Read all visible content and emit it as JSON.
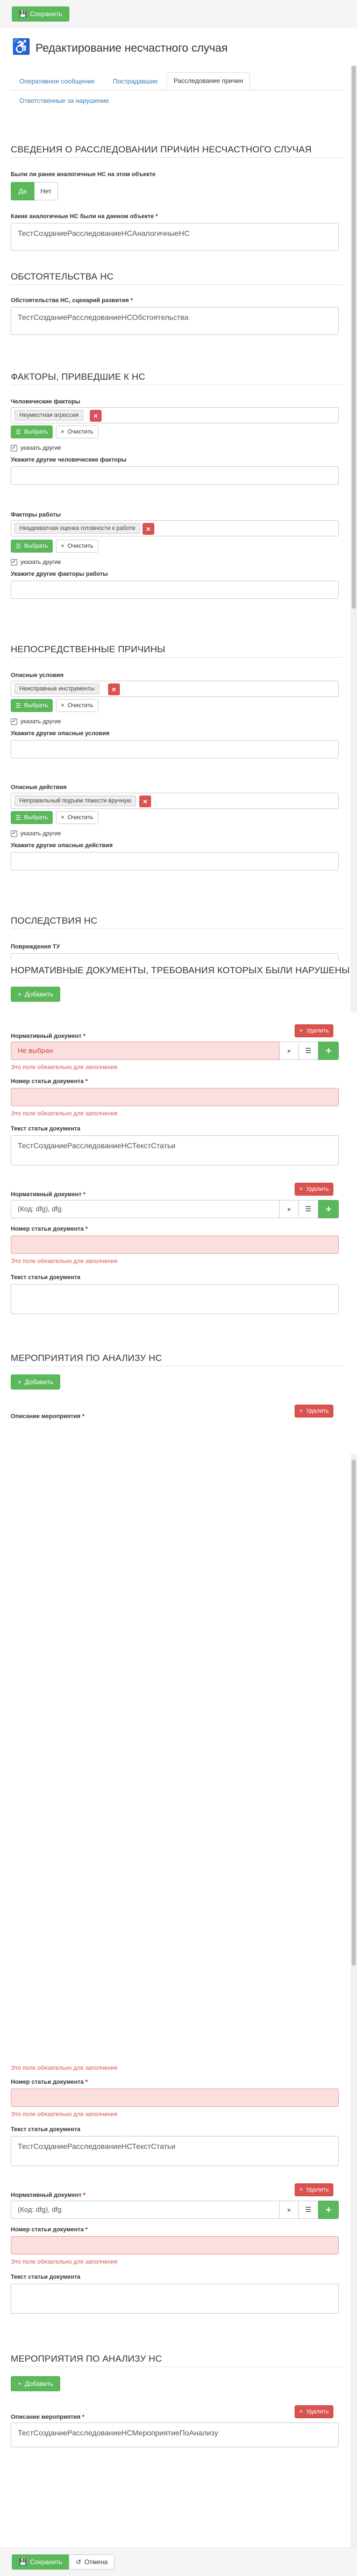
{
  "toolbar": {
    "save_label": "Сохранить"
  },
  "header": {
    "title": "Редактирование несчастного случая"
  },
  "tabs": [
    {
      "label": "Оперативное сообщение"
    },
    {
      "label": "Пострадавшие"
    },
    {
      "label": "Расследование причин"
    },
    {
      "label": "Ответственные за нарушение"
    }
  ],
  "sections": {
    "investigation": "СВЕДЕНИЯ О РАССЛЕДОВАНИИ ПРИЧИН НЕСЧАСТНОГО СЛУЧАЯ",
    "circumstances": "ОБСТОЯТЕЛЬСТВА НС",
    "factors": "ФАКТОРЫ, ПРИВЕДШИЕ К НС",
    "direct_causes": "НЕПОСРЕДСТВЕННЫЕ ПРИЧИНЫ",
    "consequences": "ПОСЛЕДСТВИЯ НС",
    "norm_docs": "НОРМАТИВНЫЕ ДОКУМЕНТЫ, ТРЕБОВАНИЯ КОТОРЫХ БЫЛИ НАРУШЕНЫ",
    "measures": "МЕРОПРИЯТИЯ ПО АНАЛИЗУ НС",
    "measures2": "МЕРОПРИЯТИЯ ПО АНАЛИЗУ НС"
  },
  "fields": {
    "similar_q": "Были ли ранее аналогичные НС на этом объекте",
    "yes": "Да",
    "no": "Нет",
    "similar_label": "Какие аналогичные НС были на данном объекте",
    "similar_value": "ТестСозданиеРасследованиеНСАналогичныеНС",
    "circ_label": "Обстоятельства НС, сценарий развития",
    "circ_value": "ТестСозданиеРасследованиеНСОбстоятельства",
    "human_factors_label": "Человеческие факторы",
    "human_factors_tag": "Неуместная агрессия",
    "human_other_check": "указать другие",
    "human_other_label": "Укажите другие человеческие факторы",
    "work_factors_label": "Факторы работы",
    "work_factors_tag": "Неадекватная оценка готовности к работе",
    "work_other_check": "указать другие",
    "work_other_label": "Укажите другие факторы работы",
    "danger_cond_label": "Опасные условия",
    "danger_cond_tag": "Неисправные инструменты",
    "danger_cond_check": "указать другие",
    "danger_cond_other_label": "Укажите другие опасные условия",
    "danger_act_label": "Опасные действия",
    "danger_act_tag": "Неправильный подъем тяжести вручную",
    "danger_act_check": "указать другие",
    "danger_act_other_label": "Укажите другие опасные действия",
    "injury_label": "Повреждения ТУ"
  },
  "buttons": {
    "choose": "Выбрать",
    "clear": "Очистить",
    "add": "Добавить",
    "delete": "Удалить",
    "cancel": "Отмена"
  },
  "required_mark": "*",
  "norm_block1": {
    "doc_label": "Нормативный документ",
    "doc_value": "Не выбран",
    "doc_error": "Это поле обязательно для заполнения",
    "article_label": "Номер статьи документа",
    "article_error": "Это поле обязательно для заполнения",
    "text_label": "Текст статьи документа",
    "text_value": "ТестСозданиеРасследованиеНСТекстСтатьи"
  },
  "norm_block2": {
    "doc_label": "Нормативный документ",
    "doc_value": "(Код: dfg), dfg",
    "article_label": "Номер статьи документа",
    "article_error": "Это поле обязательно для заполнения",
    "text_label": "Текст статьи документа"
  },
  "measure1": {
    "label": "Описание мероприятия"
  },
  "dup": {
    "error_top": "Это поле обязательно для заполнения",
    "article_label": "Номер статьи документа",
    "article_error": "Это поле обязательно для заполнения",
    "text_label": "Текст статьи документа",
    "text_value": "ТестСозданиеРасследованиеНСТекстСтатьи",
    "doc_label": "Нормативный документ",
    "doc_value": "(Код: dfg), dfg",
    "article2_label": "Номер статьи документа",
    "article2_error": "Это поле обязательно для заполнения",
    "text2_label": "Текст статьи документа",
    "measure_label": "Описание мероприятия",
    "measure_value": "ТестСозданиеРасследованиеНСМероприятиеПоАнализу"
  }
}
